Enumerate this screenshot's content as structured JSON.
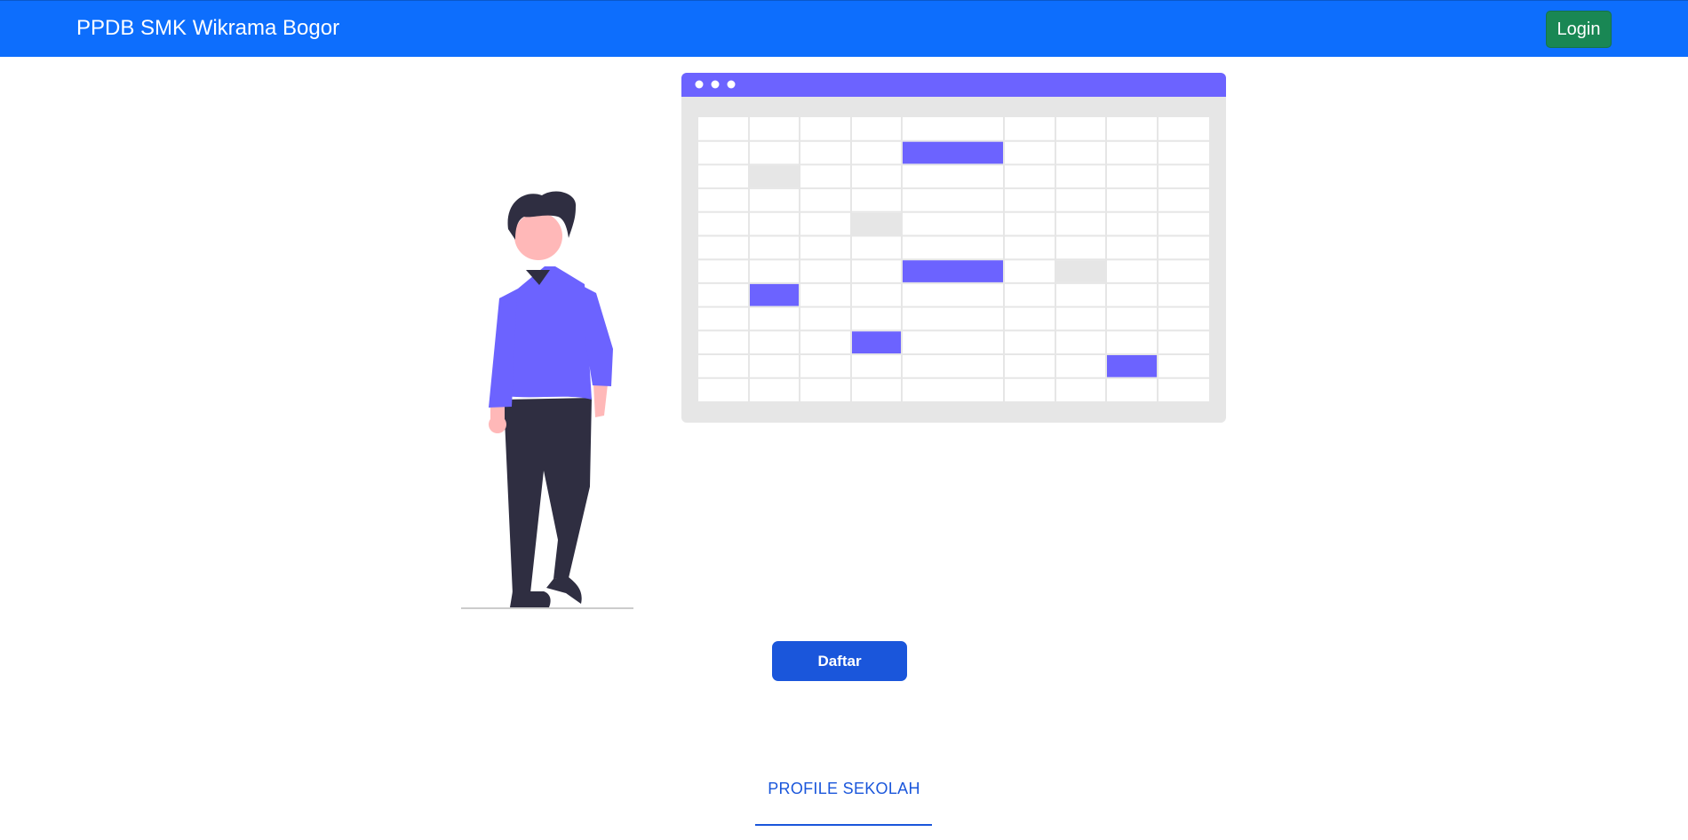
{
  "navbar": {
    "brand": "PPDB SMK Wikrama Bogor",
    "login_label": "Login",
    "background_color": "#0d6efd",
    "login_color": "#198754"
  },
  "hero": {
    "illustration": "person-with-schedule-calendar-illustration",
    "accent_color": "#6c63ff",
    "cta_label": "Daftar"
  },
  "section": {
    "title": "PROFILE SEKOLAH"
  }
}
